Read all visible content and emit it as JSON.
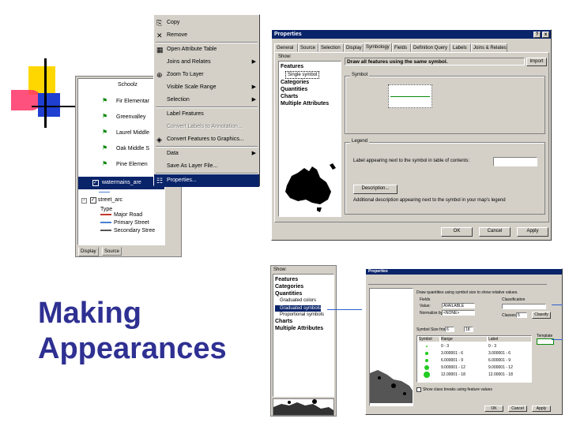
{
  "slide": {
    "heading_line1": "Making",
    "heading_line2": "Appearances"
  },
  "toc": {
    "layer_top": "Schoolz",
    "items": [
      "Fir Elementar",
      "Greenvalley",
      "Laurel Middle",
      "Oak Middle S",
      "Pine Elemen"
    ],
    "layer_selected": "watermains_are",
    "layer_street": "street_arc",
    "type_label": "Type",
    "legend": [
      {
        "label": "Major Road",
        "color": "#c0392b"
      },
      {
        "label": "Primary Street",
        "color": "#4a7fd0"
      },
      {
        "label": "Secondary Stree",
        "color": "#555555"
      }
    ],
    "tabs": [
      "Display",
      "Source"
    ]
  },
  "context_menu": {
    "items": [
      {
        "label": "Copy",
        "icon": "copy-icon",
        "glyph": "⎘",
        "disabled": false,
        "submenu": false
      },
      {
        "label": "Remove",
        "icon": "remove-icon",
        "glyph": "✕",
        "disabled": false,
        "submenu": false
      },
      {
        "label": "Open Attribute Table",
        "icon": "table-icon",
        "glyph": "▦",
        "disabled": false,
        "submenu": false
      },
      {
        "label": "Joins and Relates",
        "icon": "",
        "glyph": "",
        "disabled": false,
        "submenu": true
      },
      {
        "label": "Zoom To Layer",
        "icon": "zoom-icon",
        "glyph": "⊕",
        "disabled": false,
        "submenu": false
      },
      {
        "label": "Visible Scale Range",
        "icon": "",
        "glyph": "",
        "disabled": false,
        "submenu": true
      },
      {
        "label": "Selection",
        "icon": "",
        "glyph": "",
        "disabled": false,
        "submenu": true
      },
      {
        "label": "Label Features",
        "icon": "",
        "glyph": "",
        "disabled": false,
        "submenu": false
      },
      {
        "label": "Convert Labels to Annotation...",
        "icon": "",
        "glyph": "",
        "disabled": true,
        "submenu": false
      },
      {
        "label": "Convert Features to Graphics...",
        "icon": "convert-icon",
        "glyph": "◈",
        "disabled": false,
        "submenu": false
      },
      {
        "label": "Data",
        "icon": "",
        "glyph": "",
        "disabled": false,
        "submenu": true
      },
      {
        "label": "Save As Layer File...",
        "icon": "",
        "glyph": "",
        "disabled": false,
        "submenu": false
      },
      {
        "label": "Properties...",
        "icon": "properties-icon",
        "glyph": "☷",
        "disabled": false,
        "submenu": false
      }
    ]
  },
  "props_dialog": {
    "title": "Properties",
    "help_btn": "?",
    "close_btn": "x",
    "tabs": [
      "General",
      "Source",
      "Selection",
      "Display",
      "Symbology",
      "Fields",
      "Definition Query",
      "Labels",
      "Joins & Relates"
    ],
    "show_label": "Show:",
    "show_items": [
      {
        "label": "Features",
        "sub": [
          "Single symbol"
        ]
      },
      {
        "label": "Categories",
        "sub": []
      },
      {
        "label": "Quantities",
        "sub": []
      },
      {
        "label": "Charts",
        "sub": []
      },
      {
        "label": "Multiple Attributes",
        "sub": []
      }
    ],
    "description": "Draw all features using the same symbol.",
    "import_btn": "Import",
    "symbol_group": "Symbol",
    "legend_group": "Legend",
    "legend_label": "Label appearing next to the symbol in table of contents:",
    "description_btn": "Description...",
    "desc_text": "Additional description appearing next to the symbol in your map's legend",
    "ok": "OK",
    "cancel": "Cancel",
    "apply": "Apply"
  },
  "show_panel_zoom": {
    "show_label": "Show:",
    "items": [
      "Features",
      "Categories",
      "Quantities"
    ],
    "sub_items": [
      "Graduated colors",
      "Graduated symbols",
      "Proportional symbols"
    ],
    "items_after": [
      "Charts",
      "Multiple Attributes"
    ]
  },
  "props_small": {
    "title": "Properties",
    "description": "Draw quantities using symbol size to show relative values.",
    "fields_group": "Fields",
    "value_label": "Value:",
    "value_field": "AVAILABLE",
    "normalize_label": "Normalize by:",
    "normalize_value": "<NONE>",
    "classification_group": "Classification",
    "classes_label": "Classes:",
    "classes_value": "5",
    "classify_btn": "Classify",
    "symbol_size_label": "Symbol Size from:",
    "size_from": "6",
    "size_to": "18",
    "template_label": "Template",
    "columns": [
      "Symbol",
      "Range",
      "Label"
    ],
    "rows": [
      {
        "range": "0 - 3",
        "label": "0 - 3"
      },
      {
        "range": "3.000001 - 6",
        "label": "3.000001 - 6"
      },
      {
        "range": "6.000001 - 9",
        "label": "6.000001 - 9"
      },
      {
        "range": "9.000001 - 12",
        "label": "9.000001 - 12"
      },
      {
        "range": "12.00001 - 18",
        "label": "12.00001 - 18"
      }
    ],
    "checkbox_label": "Show class breaks using feature values",
    "ok": "OK",
    "cancel": "Cancel",
    "apply": "Apply"
  },
  "colors": {
    "heading": "#2e3092",
    "accent_yellow": "#ffd700",
    "accent_red": "#ff3366",
    "accent_blue": "#1e3fd0",
    "symbol_green": "#22cc22"
  }
}
